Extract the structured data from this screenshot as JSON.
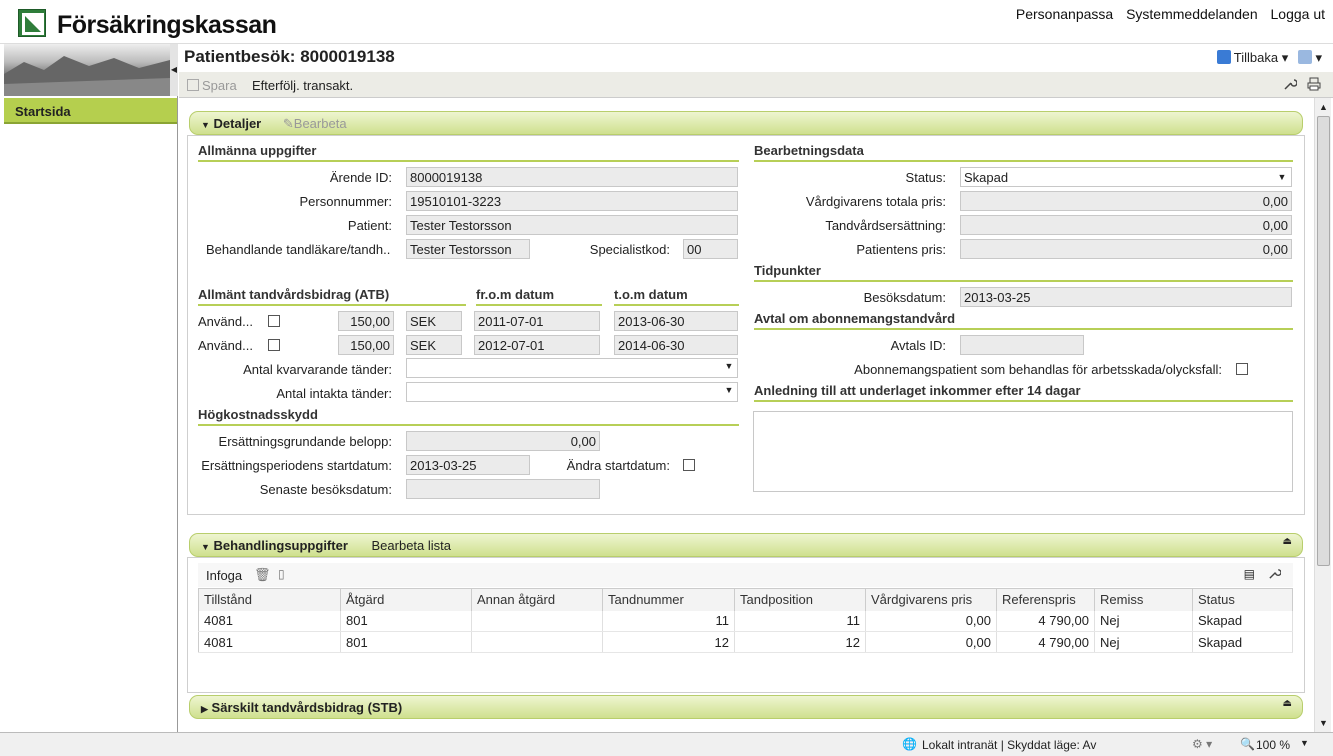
{
  "brand": {
    "name": "Försäkringskassan"
  },
  "toplinks": [
    "Personanpassa",
    "Systemmeddelanden",
    "Logga ut"
  ],
  "sidebar": {
    "start_label": "Startsida"
  },
  "page": {
    "title": "Patientbesök: 8000019138",
    "back_label": "Tillbaka"
  },
  "toolbar": {
    "save_label": "Spara",
    "followup_label": "Efterfölj. transakt."
  },
  "detaljer": {
    "title": "Detaljer",
    "edit_label": "Bearbeta",
    "allmanna": {
      "title": "Allmänna uppgifter",
      "arende_label": "Ärende ID:",
      "arende_value": "8000019138",
      "personnummer_label": "Personnummer:",
      "personnummer_value": "19510101-3223",
      "patient_label": "Patient:",
      "patient_value": "Tester Testorsson",
      "behandlande_label": "Behandlande tandläkare/tandh..",
      "behandlande_value": "Tester Testorsson",
      "specialist_label": "Specialistkod:",
      "specialist_value": "00"
    },
    "atb": {
      "title": "Allmänt tandvårdsbidrag (ATB)",
      "from_header": "fr.o.m datum",
      "tom_header": "t.o.m datum",
      "rows": [
        {
          "label": "Använd...",
          "amount": "150,00",
          "currency": "SEK",
          "from": "2011-07-01",
          "to": "2013-06-30"
        },
        {
          "label": "Använd...",
          "amount": "150,00",
          "currency": "SEK",
          "from": "2012-07-01",
          "to": "2014-06-30"
        }
      ],
      "kvarvarande_label": "Antal kvarvarande tänder:",
      "intakta_label": "Antal intakta tänder:"
    },
    "hogkostnad": {
      "title": "Högkostnadsskydd",
      "grund_label": "Ersättningsgrundande belopp:",
      "grund_value": "0,00",
      "start_label": "Ersättningsperiodens startdatum:",
      "start_value": "2013-03-25",
      "andra_label": "Ändra startdatum:",
      "senaste_label": "Senaste besöksdatum:",
      "senaste_value": ""
    },
    "bearbetning": {
      "title": "Bearbetningsdata",
      "status_label": "Status:",
      "status_value": "Skapad",
      "totala_label": "Vårdgivarens totala pris:",
      "totala_value": "0,00",
      "ersattning_label": "Tandvårdsersättning:",
      "ersattning_value": "0,00",
      "patientpris_label": "Patientens pris:",
      "patientpris_value": "0,00"
    },
    "tidpunkter": {
      "title": "Tidpunkter",
      "besok_label": "Besöksdatum:",
      "besok_value": "2013-03-25"
    },
    "avtal": {
      "title": "Avtal om abonnemangstandvård",
      "id_label": "Avtals ID:",
      "id_value": "",
      "arbetsskada_label": "Abonnemangspatient som behandlas för arbetsskada/olycksfall:"
    },
    "anledning": {
      "title": "Anledning till att underlaget inkommer efter 14 dagar",
      "value": ""
    }
  },
  "behandling": {
    "title": "Behandlingsuppgifter",
    "edit_list_label": "Bearbeta lista",
    "insert_label": "Infoga",
    "columns": [
      "Tillstånd",
      "Åtgärd",
      "Annan åtgärd",
      "Tandnummer",
      "Tandposition",
      "Vårdgivarens pris",
      "Referenspris",
      "Remiss",
      "Status"
    ],
    "rows": [
      [
        "4081",
        "801",
        "",
        "11",
        "11",
        "0,00",
        "4 790,00",
        "Nej",
        "Skapad"
      ],
      [
        "4081",
        "801",
        "",
        "12",
        "12",
        "0,00",
        "4 790,00",
        "Nej",
        "Skapad"
      ]
    ]
  },
  "stb": {
    "title": "Särskilt tandvårdsbidrag (STB)"
  },
  "statusbar": {
    "zone": "Lokalt intranät | Skyddat läge: Av",
    "zoom": "100 %"
  },
  "colors": {
    "accent_green": "#b5cf4e",
    "logo_green": "#2f7d3a"
  }
}
